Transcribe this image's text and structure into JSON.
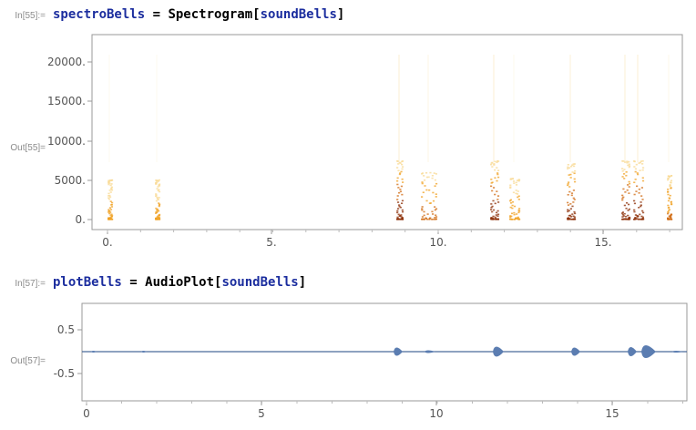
{
  "cells": {
    "in55": "In[55]:=",
    "out55": "Out[55]=",
    "in57": "In[57]:=",
    "out57": "Out[57]="
  },
  "input1": {
    "var": "spectroBells",
    "eq": " = ",
    "fn": "Spectrogram",
    "lb": "[",
    "arg": "soundBells",
    "rb": "]"
  },
  "input2": {
    "var": "plotBells",
    "eq": " = ",
    "fn": "AudioPlot",
    "lb": "[",
    "arg": "soundBells",
    "rb": "]"
  },
  "colors": {
    "symbol": "#1b2d9e",
    "frame": "#888888",
    "spectro_hot": "#8a2a00",
    "spectro_mid": "#f0a020",
    "wave": "#5b7db1"
  },
  "spectrogram": {
    "x_ticks": [
      "0.",
      "5.",
      "10.",
      "15."
    ],
    "y_ticks": [
      "0.",
      "5000.",
      "10000.",
      "15000.",
      "20000."
    ]
  },
  "audioplot": {
    "x_ticks": [
      "0",
      "5",
      "10",
      "15"
    ],
    "y_ticks": [
      "0.5",
      "-0.5"
    ]
  }
}
